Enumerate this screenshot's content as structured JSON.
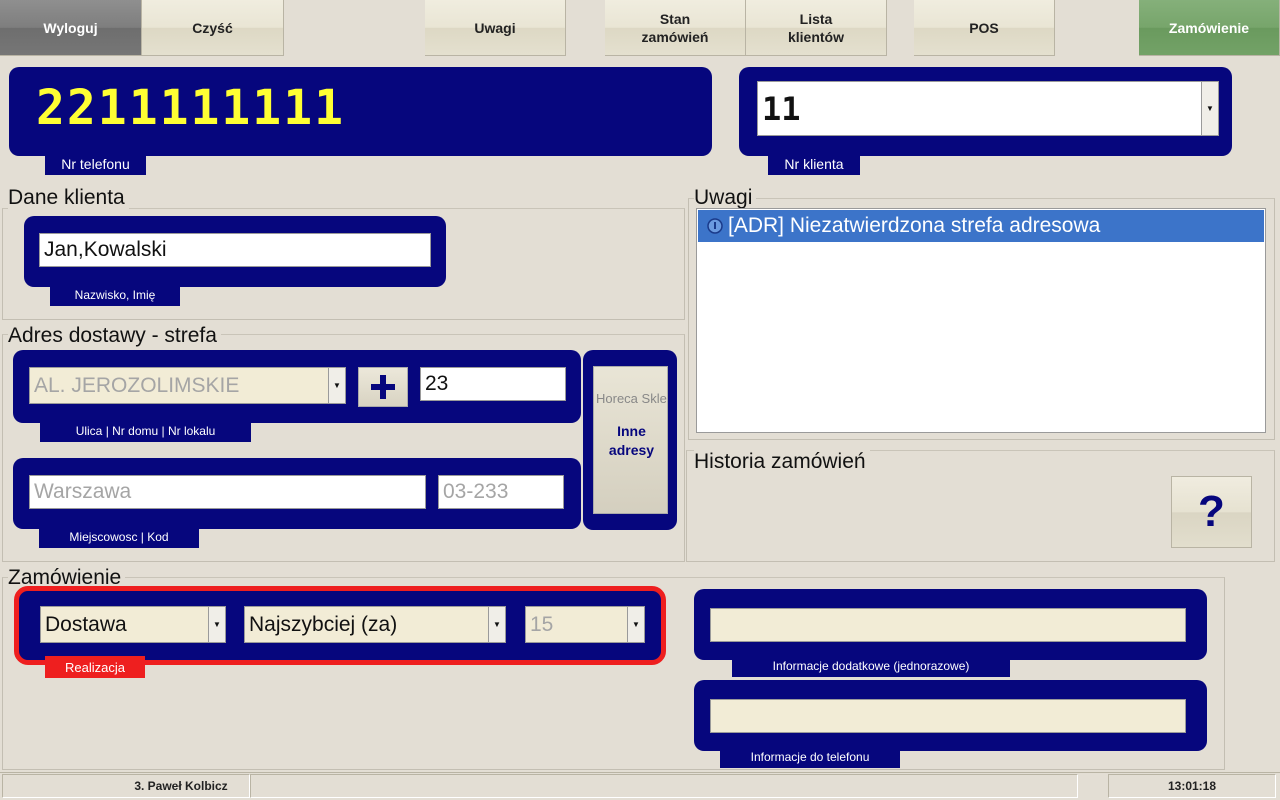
{
  "toolbar": {
    "logout": "Wyloguj",
    "clear": "Czyść",
    "notes": "Uwagi",
    "order_status": "Stan\nzamówień",
    "client_list": "Lista\nklientów",
    "pos": "POS",
    "order": "Zamówienie"
  },
  "phone": {
    "value": "2211111111",
    "label": "Nr telefonu"
  },
  "client_no": {
    "value": "11",
    "label": "Nr klienta"
  },
  "client_data": {
    "title": "Dane klienta",
    "name": "Jan,Kowalski",
    "name_label": "Nazwisko, Imię"
  },
  "address": {
    "title": "Adres dostawy - strefa",
    "street": "AL. JEROZOLIMSKIE",
    "house": "23",
    "street_label": "Ulica | Nr domu | Nr lokalu",
    "city": "Warszawa",
    "postal": "03-233",
    "city_label": "Miejscowosc | Kod",
    "side_top": "Horeca Sklep",
    "side_button": "Inne\nadresy"
  },
  "notes": {
    "title": "Uwagi",
    "items": [
      "[ADR] Niezatwierdzona strefa adresowa"
    ]
  },
  "history": {
    "title": "Historia zamówień",
    "button": "?"
  },
  "order": {
    "title": "Zamówienie",
    "type": "Dostawa",
    "timing": "Najszybciej (za)",
    "minutes": "15",
    "label": "Realizacja",
    "extra_info_label": "Informacje dodatkowe  (jednorazowe)",
    "phone_info_label": "Informacje do telefonu"
  },
  "status": {
    "user": "3. Paweł Kolbicz",
    "time": "13:01:18"
  },
  "colors": {
    "navy": "#06067d",
    "phone_text": "#ffff33",
    "highlight": "#ee1f1f",
    "select": "#3c74c9"
  }
}
